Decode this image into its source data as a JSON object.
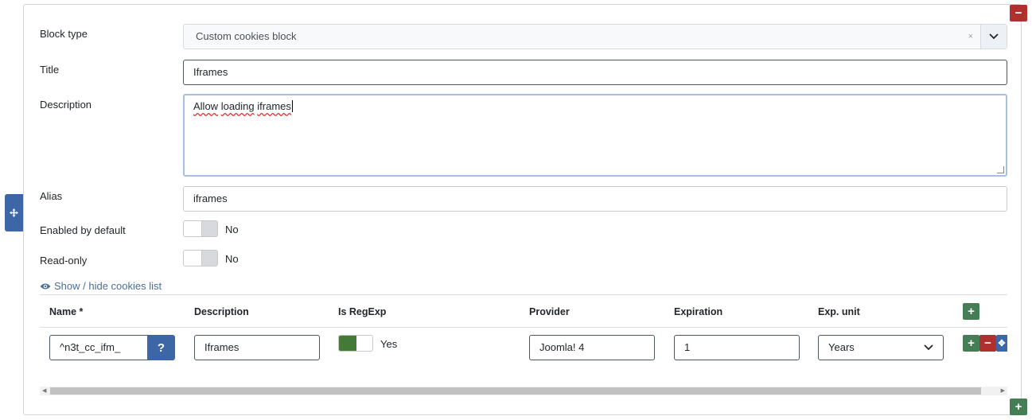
{
  "form": {
    "block_type": {
      "label": "Block type",
      "value": "Custom cookies block",
      "clear": "×"
    },
    "title": {
      "label": "Title",
      "value": "Iframes"
    },
    "description": {
      "label": "Description",
      "value_a": "Allow",
      "value_b": "loading",
      "value_c": "iframes"
    },
    "alias": {
      "label": "Alias",
      "value": "iframes"
    },
    "enabled_by_default": {
      "label": "Enabled by default",
      "state": "No"
    },
    "read_only": {
      "label": "Read-only",
      "state": "No"
    },
    "toggle_cookies_link": "Show / hide cookies list"
  },
  "cookies_table": {
    "headers": [
      "Name *",
      "Description",
      "Is RegExp",
      "Provider",
      "Expiration",
      "Exp. unit"
    ],
    "rows": [
      {
        "name": "^n3t_cc_ifm_",
        "help": "?",
        "description": "Iframes",
        "is_regexp": "Yes",
        "provider": "Joomla! 4",
        "expiration": "1",
        "exp_unit": "Years"
      }
    ]
  },
  "colors": {
    "green": "#457d54",
    "red": "#b02f2f",
    "blue": "#3c66a6"
  }
}
